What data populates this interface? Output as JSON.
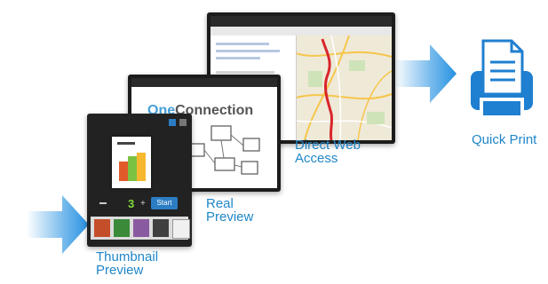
{
  "labels": {
    "thumbnail_preview": [
      "Thumbnail",
      "Preview"
    ],
    "real_preview": [
      "Real",
      "Preview"
    ],
    "direct_web_access": [
      "Direct Web",
      "Access"
    ],
    "quick_print": "Quick Print"
  },
  "thumbnail_screen": {
    "copies": "3",
    "start_label": "Start"
  },
  "real_preview_screen": {
    "brand_prefix": "One",
    "brand_suffix": "Connection"
  },
  "colors": {
    "label_blue": "#1f86c8",
    "arrow_blue": "#1a8be0",
    "printer_blue": "#1f7fd0",
    "route_red": "#d8262b"
  },
  "icons": [
    "arrow-right-icon",
    "arrow-right-icon",
    "printer-icon"
  ]
}
